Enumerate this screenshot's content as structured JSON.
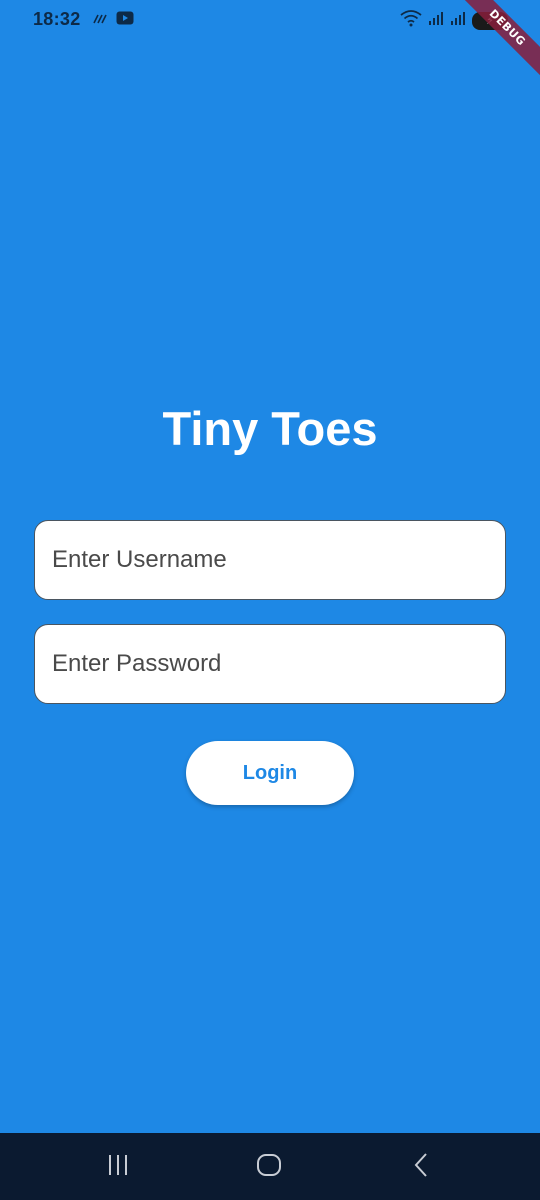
{
  "status_bar": {
    "time": "18:32",
    "left_icons": [
      "voicemail-icon",
      "youtube-icon"
    ],
    "right_icons": [
      "wifi-icon",
      "signal-icon",
      "signal-icon",
      "battery-charging-icon"
    ]
  },
  "debug_banner": "DEBUG",
  "app": {
    "title": "Tiny Toes",
    "username_placeholder": "Enter Username",
    "password_placeholder": "Enter Password",
    "login_label": "Login"
  },
  "nav_bar": {
    "buttons": [
      "recents-icon",
      "home-icon",
      "back-icon"
    ]
  },
  "colors": {
    "background": "#1E88E5",
    "title_text": "#FFFFFF",
    "button_text": "#1E88E5",
    "nav_bar": "#0B1A30"
  }
}
